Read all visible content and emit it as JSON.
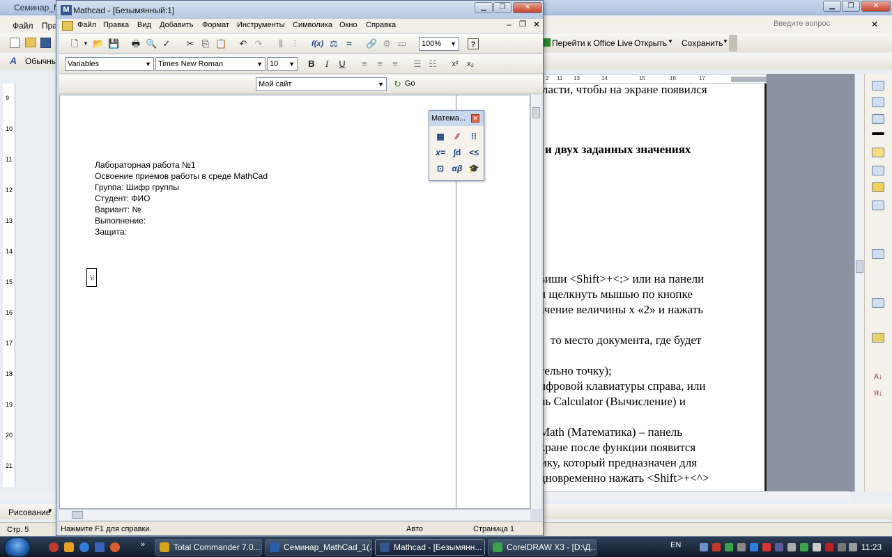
{
  "colors": {
    "accent": "#34558f",
    "taskbar": "#1a2738",
    "doc_bg": "#ffffff"
  },
  "word": {
    "title": "Семинар_Ma",
    "menu": [
      "Файл",
      "Прав"
    ],
    "help_placeholder": "Введите вопрос",
    "toolbar": {
      "office_live": "Перейти к Office Live",
      "open": "Открыть",
      "save": "Сохранить",
      "style": "Обычный"
    },
    "ruler_marks": [
      "2",
      "11",
      "13",
      "14",
      "15",
      "16",
      "17"
    ],
    "vruler_marks": [
      "9",
      "10",
      "11",
      "12",
      "13",
      "14",
      "15",
      "16",
      "17",
      "18",
      "19",
      "20",
      "21"
    ],
    "doc_lines": [
      "ласти, чтобы на экране появился",
      "и двух заданных значениях",
      "виши <Shift>+<:> или на панели",
      "и щелкнуть мышью по кнопке",
      "ачение величины x «2» и нажать",
      "то место документа, где будет",
      "тельно точку);",
      "ифровой клавиатуры справа, или",
      "ль Calculator (Вычисление) и",
      "Math (Математика) – панель",
      "кране после функции появится",
      "мку, который предназначен для",
      "дновременно нажать <Shift>+<^>"
    ],
    "draw_label": "Рисование",
    "status_page": "Стр. 5"
  },
  "mathcad": {
    "title": "Mathcad - [Безымянный:1]",
    "logo": "M",
    "menu": [
      "Файл",
      "Правка",
      "Вид",
      "Добавить",
      "Формат",
      "Инструменты",
      "Символика",
      "Окно",
      "Справка"
    ],
    "zoom": "100%",
    "style_select": "Variables",
    "font_select": "Times New Roman",
    "size_select": "10",
    "bold": "B",
    "italic": "I",
    "underline": "U",
    "superscript": "x²",
    "subscript": "x₂",
    "site_select": "Мой сайт",
    "go_label": "Go",
    "doc_lines": [
      "Лабораторная работа №1",
      "Освоение приемов работы в среде MathCad",
      "Группа: Шифр группы",
      "Студент: ФИО",
      "Вариант: №",
      "Выполнение:",
      "Защита:"
    ],
    "cursor_mark": ":=",
    "palette_title": "Матема...",
    "palette_buttons": [
      "▦",
      "⁄⁄",
      "⁞⁞",
      "x=",
      "∫d",
      "<≤",
      "⊡",
      "αβ",
      "🎓"
    ],
    "status_help": "Нажмите F1 для справки.",
    "status_mode": "Авто",
    "status_page": "Страница 1"
  },
  "taskbar": {
    "items": [
      {
        "label": "Total Commander 7.0...",
        "color": "#d6a21f"
      },
      {
        "label": "Семинар_MathCad_1(...",
        "color": "#2b5caa"
      },
      {
        "label": "Mathcad - [Безымянн...",
        "color": "#34558f"
      },
      {
        "label": "CorelDRAW X3 - [D:\\Д...",
        "color": "#3aa34a"
      }
    ],
    "lang": "EN",
    "clock": "11:23"
  }
}
